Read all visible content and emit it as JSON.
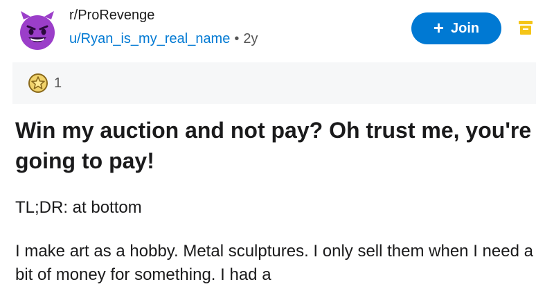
{
  "post": {
    "subreddit": "r/ProRevenge",
    "username": "u/Ryan_is_my_real_name",
    "separator": "•",
    "age": "2y",
    "join_label": "Join",
    "award_count": "1",
    "title": "Win my auction and not pay? Oh trust me, you're going to pay!",
    "body": [
      "TL;DR: at bottom",
      "I make art as a hobby. Metal sculptures. I only sell them when I need a bit of money for something. I had a"
    ]
  },
  "colors": {
    "accent": "#0079d3",
    "avatar_purple": "#9b3ec9",
    "menu_icon": "#f5c518",
    "award_bar_bg": "#f6f7f8"
  },
  "icons": {
    "avatar": "devil-face-icon",
    "join": "plus-icon",
    "menu": "bookmark-menu-icon",
    "award": "star-award-icon"
  }
}
